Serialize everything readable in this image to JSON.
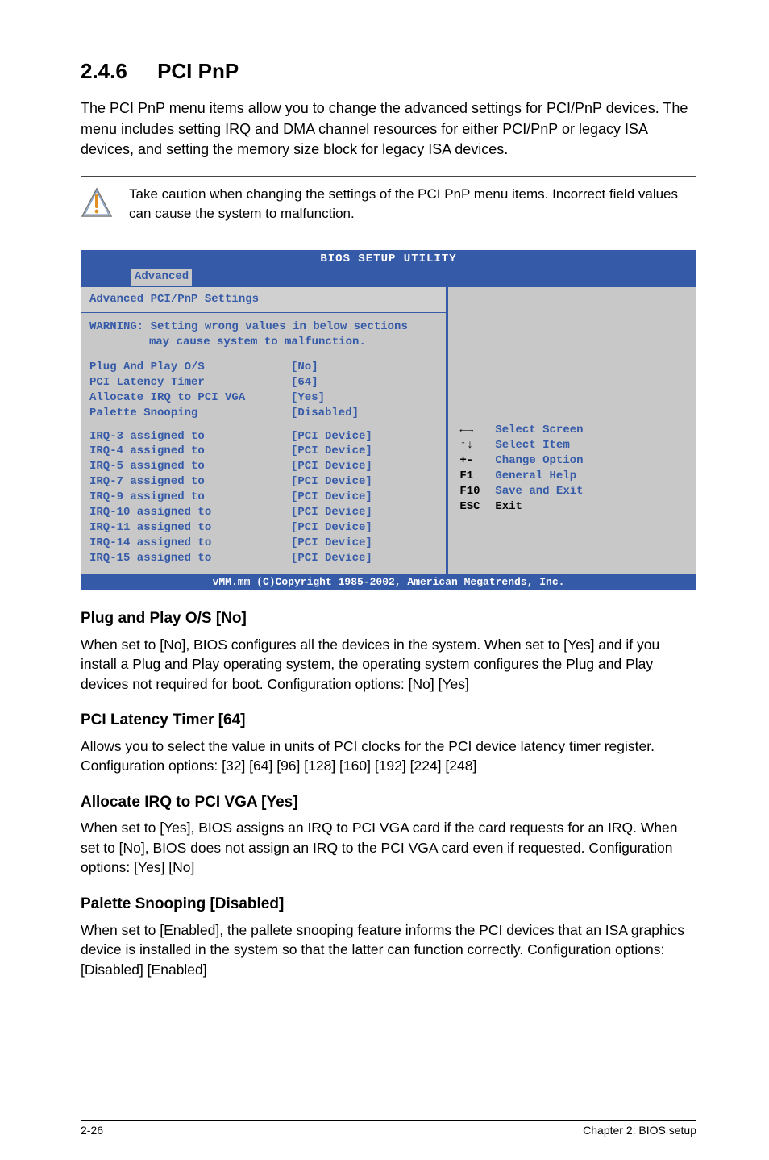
{
  "heading": {
    "num": "2.4.6",
    "title": "PCI PnP"
  },
  "intro": "The PCI PnP menu items allow you to change the advanced settings for PCI/PnP devices. The menu includes setting IRQ and DMA channel resources for either PCI/PnP or legacy ISA devices, and setting the memory size block for legacy ISA devices.",
  "caution": "Take caution when changing the settings of the PCI PnP menu items. Incorrect field values can cause the system to malfunction.",
  "bios": {
    "title": "BIOS SETUP UTILITY",
    "tab": "Advanced",
    "section_title": "Advanced PCI/PnP Settings",
    "warning_l1": "WARNING: Setting wrong values in below sections",
    "warning_l2": "may cause system to malfunction.",
    "top_settings": [
      {
        "label": "Plug And Play O/S",
        "value": "[No]"
      },
      {
        "label": "PCI Latency Timer",
        "value": "[64]"
      },
      {
        "label": "Allocate IRQ to PCI VGA",
        "value": "[Yes]"
      },
      {
        "label": "Palette Snooping",
        "value": "[Disabled]"
      }
    ],
    "irq": [
      {
        "label": "IRQ-3 assigned to",
        "value": "[PCI Device]"
      },
      {
        "label": "IRQ-4 assigned to",
        "value": "[PCI Device]"
      },
      {
        "label": "IRQ-5 assigned to",
        "value": "[PCI Device]"
      },
      {
        "label": "IRQ-7 assigned to",
        "value": "[PCI Device]"
      },
      {
        "label": "IRQ-9 assigned to",
        "value": "[PCI Device]"
      },
      {
        "label": "IRQ-10 assigned to",
        "value": "[PCI Device]"
      },
      {
        "label": "IRQ-11 assigned to",
        "value": "[PCI Device]"
      },
      {
        "label": "IRQ-14 assigned to",
        "value": "[PCI Device]"
      },
      {
        "label": "IRQ-15 assigned to",
        "value": "[PCI Device]"
      }
    ],
    "help": [
      {
        "key": "←→",
        "txt": "Select Screen"
      },
      {
        "key": "↑↓",
        "txt": "Select Item"
      },
      {
        "key": "+-",
        "txt": "Change Option"
      },
      {
        "key": "F1",
        "txt": "General Help"
      },
      {
        "key": "F10",
        "txt": "Save and Exit"
      },
      {
        "key": "ESC",
        "txt": "Exit"
      }
    ],
    "footer": "vMM.mm (C)Copyright 1985-2002, American Megatrends, Inc."
  },
  "sections": [
    {
      "h": "Plug and Play O/S [No]",
      "p": "When set to [No], BIOS configures all the devices in the system. When set to [Yes] and if you install a Plug and Play operating system, the operating system configures the Plug and Play devices not required for boot. Configuration options: [No] [Yes]"
    },
    {
      "h": "PCI Latency Timer [64]",
      "p": "Allows you to select the value in units of PCI clocks for the PCI device latency timer register. Configuration options: [32] [64] [96] [128] [160] [192] [224] [248]"
    },
    {
      "h": "Allocate IRQ to PCI VGA [Yes]",
      "p": "When set to [Yes], BIOS assigns an IRQ to PCI VGA card if the card requests for an IRQ. When set to [No], BIOS does not assign an IRQ to the PCI VGA card even if requested. Configuration options: [Yes] [No]"
    },
    {
      "h": "Palette Snooping [Disabled]",
      "p": "When set to [Enabled], the pallete snooping feature informs the PCI devices that an ISA graphics device is installed in the system so that the latter can function correctly. Configuration options: [Disabled] [Enabled]"
    }
  ],
  "footer": {
    "left": "2-26",
    "right": "Chapter 2: BIOS setup"
  }
}
